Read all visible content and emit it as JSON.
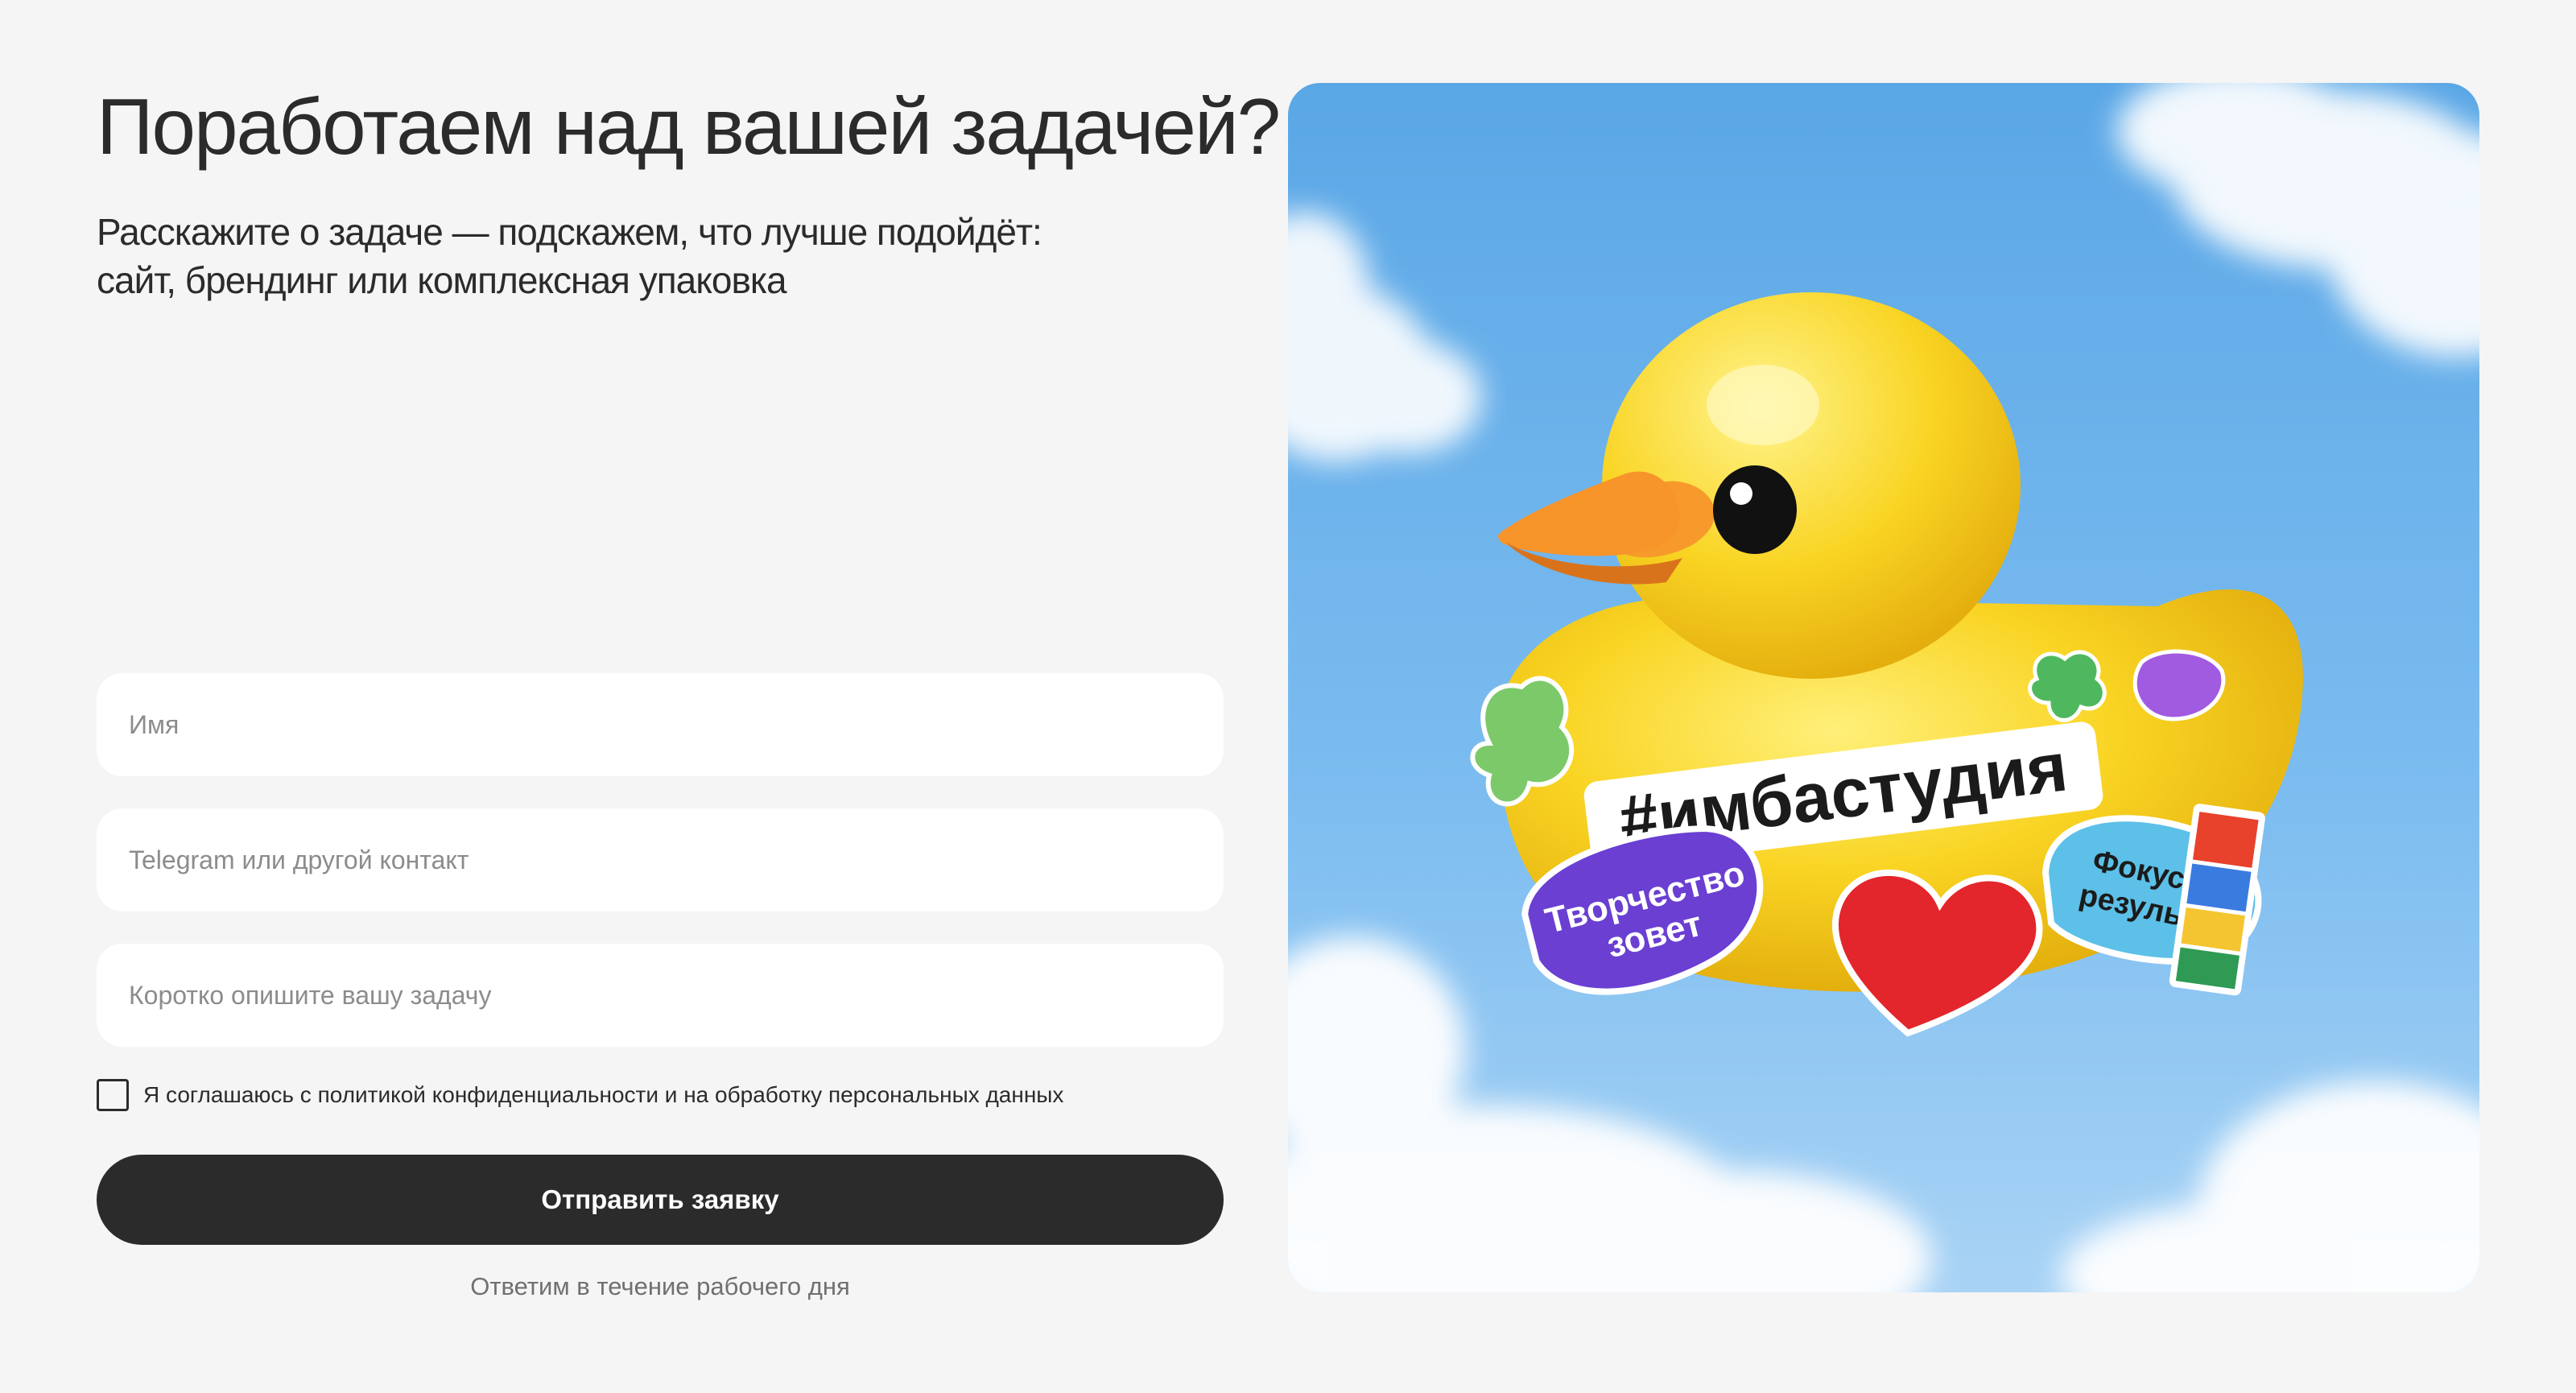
{
  "header": {
    "title": "Поработаем над вашей задачей?",
    "subtitle_line1": "Расскажите о задаче — подскажем, что лучше подойдёт:",
    "subtitle_line2": "сайт, брендинг или комплексная упаковка"
  },
  "form": {
    "name_placeholder": "Имя",
    "contact_placeholder": "Telegram или другой контакт",
    "task_placeholder": "Коротко опишите вашу задачу",
    "consent_text": "Я соглашаюсь с политикой конфиденциальности и на обработку персональных данных",
    "consent_checked": false,
    "submit_label": "Отправить заявку",
    "note": "Ответим в течение рабочего дня"
  },
  "illustration": {
    "description_icon": "rubber-duck-image",
    "hashtag": "#имбастудия",
    "sticker_left_line1": "Творчество",
    "sticker_left_line2": "зовет",
    "sticker_right_line1": "Фокус на",
    "sticker_right_line2": "результат"
  },
  "colors": {
    "background": "#f5f5f5",
    "text": "#2b2b2b",
    "button": "#2b2b2b",
    "field": "#ffffff",
    "sky": "#6fb3ea",
    "duck": "#f7cf1c"
  }
}
